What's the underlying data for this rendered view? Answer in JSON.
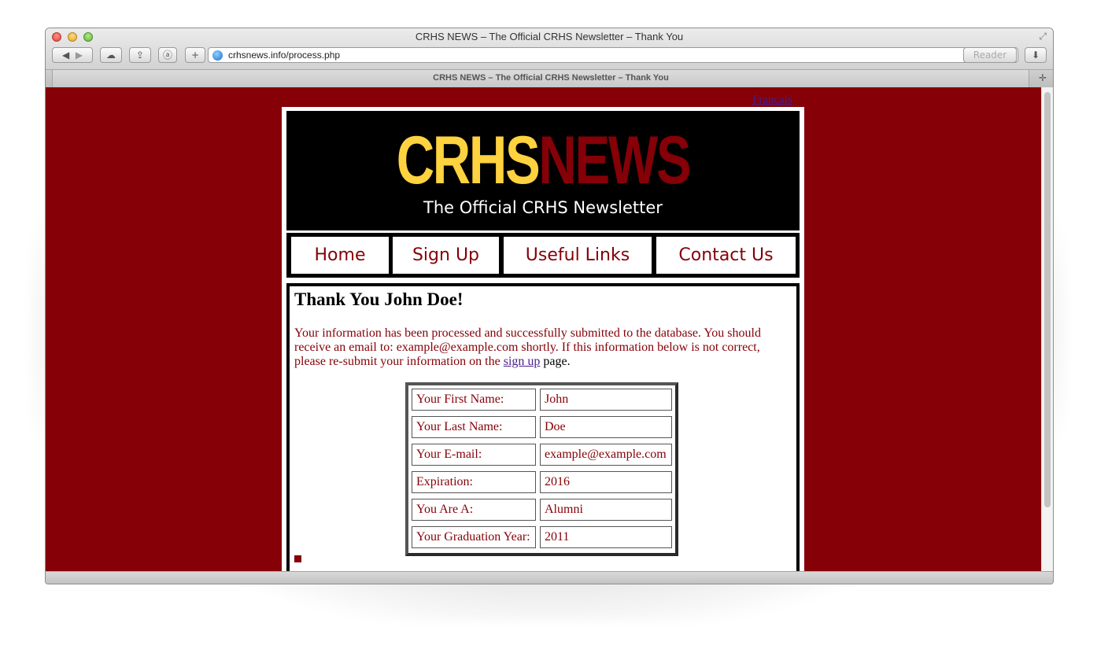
{
  "window": {
    "title": "CRHS NEWS – The Official CRHS Newsletter – Thank You",
    "url": "crhsnews.info/process.php",
    "reader_label": "Reader",
    "tab_title": "CRHS NEWS – The Official CRHS Newsletter – Thank You"
  },
  "page": {
    "language_link": "Francais",
    "logo_left": "CRHS",
    "logo_right": "NEWS",
    "tagline": "The Official CRHS Newsletter",
    "nav": [
      "Home",
      "Sign Up",
      "Useful Links",
      "Contact Us"
    ],
    "heading": "Thank You John Doe!",
    "message_before": "Your information has been processed and successfully submitted to the database. You should receive an email to: example@example.com shortly. If this information below is not correct, please re-submit your information on the ",
    "message_link": "sign up",
    "message_after": " page.",
    "table": [
      {
        "label": "Your First Name:",
        "value": "John"
      },
      {
        "label": "Your Last Name:",
        "value": "Doe"
      },
      {
        "label": "Your E-mail:",
        "value": "example@example.com"
      },
      {
        "label": "Expiration:",
        "value": "2016"
      },
      {
        "label": "You Are A:",
        "value": "Alumni"
      },
      {
        "label": "Your Graduation Year:",
        "value": "2011"
      }
    ]
  },
  "colors": {
    "background": "#850007",
    "logo_yellow": "#ffd23f",
    "text_dark_red": "#850007",
    "link_purple": "#4a1e8a"
  },
  "icons": [
    "back-icon",
    "forward-icon",
    "icloud-icon",
    "share-icon",
    "amazon-icon",
    "add-bookmark-icon",
    "globe-icon",
    "reload-icon",
    "download-icon",
    "fullscreen-icon",
    "new-tab-icon"
  ]
}
